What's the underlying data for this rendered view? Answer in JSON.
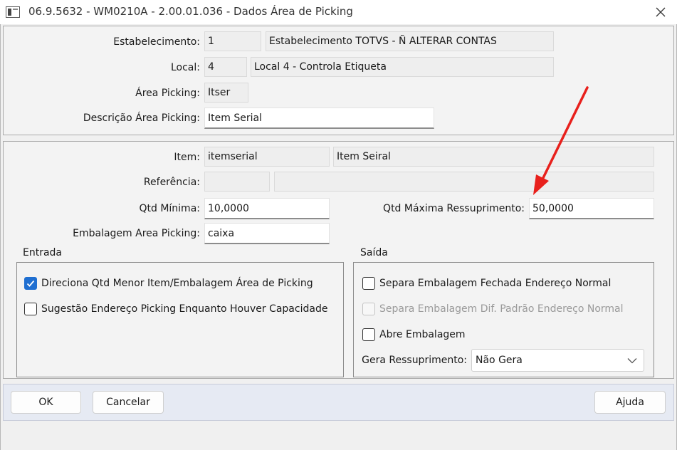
{
  "window": {
    "title": "06.9.5632 - WM0210A - 2.00.01.036 - Dados Área de Picking"
  },
  "header": {
    "estabelecimento": {
      "label": "Estabelecimento:",
      "code": "1",
      "name": "Estabelecimento TOTVS - Ñ ALTERAR CONTAS"
    },
    "local": {
      "label": "Local:",
      "code": "4",
      "name": "Local 4 - Controla Etiqueta"
    },
    "area_picking": {
      "label": "Área Picking:",
      "value": "Itser"
    },
    "descricao_area_picking": {
      "label": "Descrição Área Picking:",
      "value": "Item Serial"
    }
  },
  "detail": {
    "item": {
      "label": "Item:",
      "code": "itemserial",
      "name": "Item Seiral"
    },
    "referencia": {
      "label": "Referência:",
      "code": "",
      "name": ""
    },
    "qtd_minima": {
      "label": "Qtd Mínima:",
      "value": "10,0000"
    },
    "qtd_maxima": {
      "label": "Qtd Máxima Ressuprimento:",
      "value": "50,0000"
    },
    "embalagem": {
      "label": "Embalagem Area Picking:",
      "value": "caixa"
    }
  },
  "entrada": {
    "title": "Entrada",
    "options": [
      {
        "label": "Direciona Qtd Menor Item/Embalagem Área de Picking",
        "checked": true,
        "enabled": true
      },
      {
        "label": "Sugestão Endereço Picking Enquanto Houver Capacidade",
        "checked": false,
        "enabled": true
      }
    ]
  },
  "saida": {
    "title": "Saída",
    "options": [
      {
        "label": "Separa Embalagem Fechada Endereço Normal",
        "checked": false,
        "enabled": true
      },
      {
        "label": "Separa Embalagem Dif. Padrão Endereço Normal",
        "checked": false,
        "enabled": false
      },
      {
        "label": "Abre Embalagem",
        "checked": false,
        "enabled": true
      }
    ],
    "gera_ressuprimento": {
      "label": "Gera Ressuprimento:",
      "selected": "Não Gera"
    }
  },
  "buttons": {
    "ok": "OK",
    "cancel": "Cancelar",
    "help": "Ajuda"
  },
  "colors": {
    "accent": "#1f6fd1",
    "annotation_arrow": "#e8201c",
    "button_bar": "#e6eaf3"
  }
}
